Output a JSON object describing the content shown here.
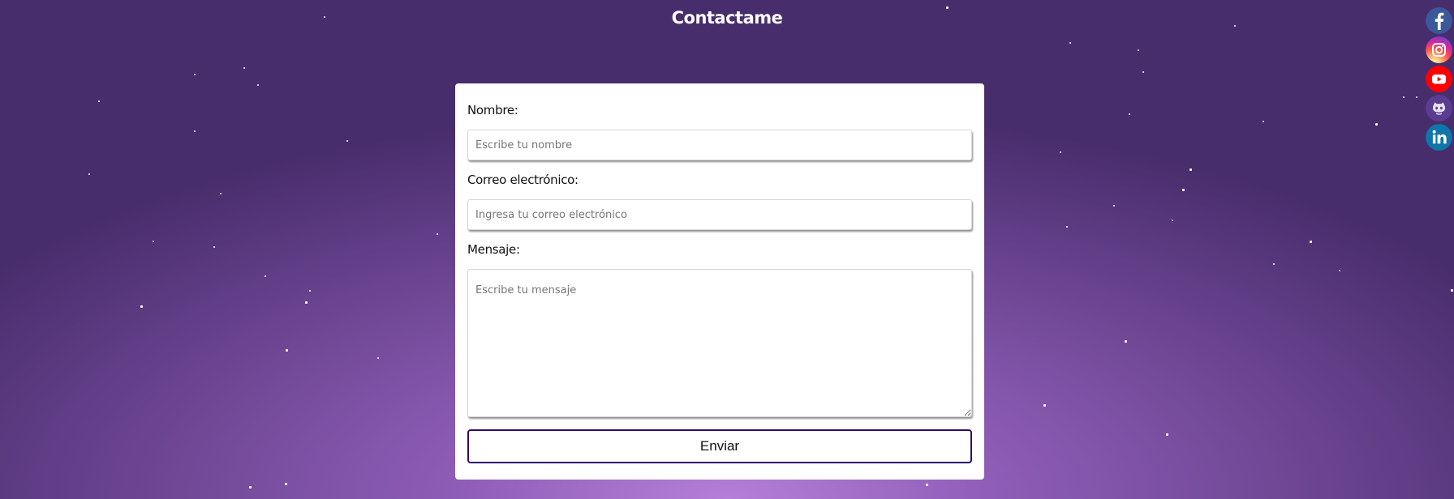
{
  "page": {
    "title": "Contactame"
  },
  "form": {
    "name_label": "Nombre:",
    "name_placeholder": "Escribe tu nombre",
    "name_value": "",
    "email_label": "Correo electrónico:",
    "email_placeholder": "Ingresa tu correo electrónico",
    "email_value": "",
    "message_label": "Mensaje:",
    "message_placeholder": "Escribe tu mensaje",
    "message_value": "",
    "submit_label": "Enviar"
  },
  "social": [
    {
      "network": "Facebook",
      "icon": "facebook-icon",
      "color": "#3b5998"
    },
    {
      "network": "Instagram",
      "icon": "instagram-icon",
      "color": "#d6249f"
    },
    {
      "network": "YouTube",
      "icon": "youtube-icon",
      "color": "#ff0000"
    },
    {
      "network": "GitHub",
      "icon": "github-icon",
      "color": "#5b3d8f"
    },
    {
      "network": "LinkedIn",
      "icon": "linkedin-icon",
      "color": "#0e76a8"
    }
  ],
  "colors": {
    "background_center": "#b57fd8",
    "background_edge": "#482d6c",
    "card": "#ffffff",
    "button_border": "#2e0b6b"
  }
}
